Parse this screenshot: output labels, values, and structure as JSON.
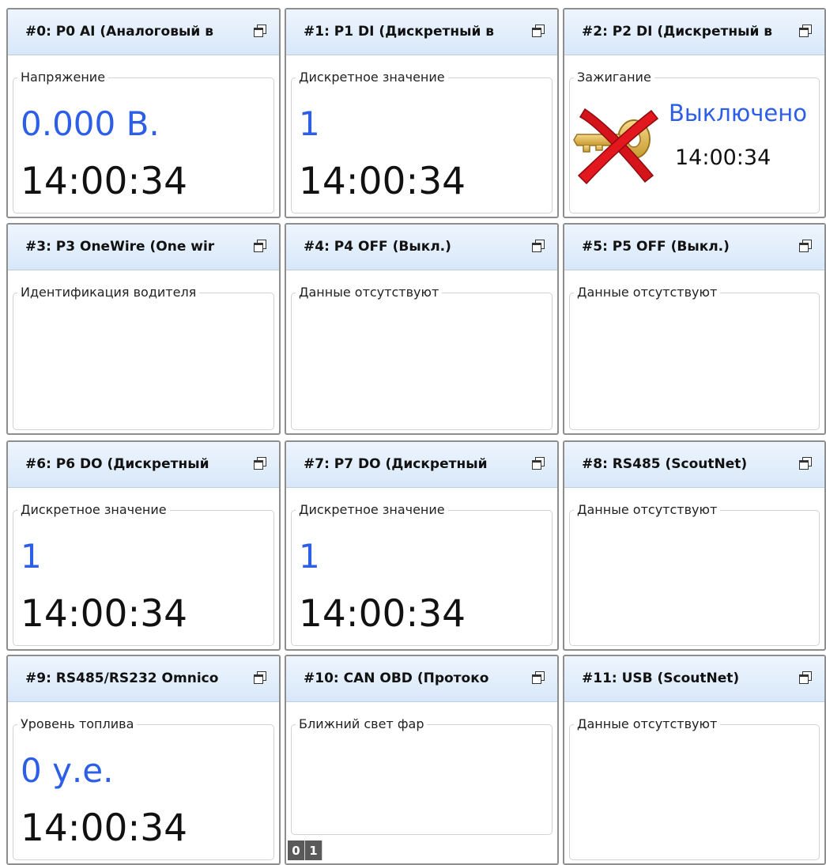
{
  "tiles": [
    {
      "title": "#0: P0 AI (Аналоговый в",
      "legend": "Напряжение",
      "value": "0.000 В.",
      "time": "14:00:34"
    },
    {
      "title": "#1: P1 DI (Дискретный в",
      "legend": "Дискретное значение",
      "value": "1",
      "time": "14:00:34"
    },
    {
      "title": "#2: P2 DI (Дискретный в",
      "legend": "Зажигание",
      "value": "Выключено",
      "time": "14:00:34"
    },
    {
      "title": "#3: P3 OneWire (One wir",
      "legend": "Идентификация водителя"
    },
    {
      "title": "#4: P4 OFF (Выкл.)",
      "legend": "Данные отсутствуют"
    },
    {
      "title": "#5: P5 OFF (Выкл.)",
      "legend": "Данные отсутствуют"
    },
    {
      "title": "#6: P6 DO (Дискретный",
      "legend": "Дискретное значение",
      "value": "1",
      "time": "14:00:34"
    },
    {
      "title": "#7: P7 DO (Дискретный",
      "legend": "Дискретное значение",
      "value": "1",
      "time": "14:00:34"
    },
    {
      "title": "#8: RS485 (ScoutNet)",
      "legend": "Данные отсутствуют"
    },
    {
      "title": "#9: RS485/RS232 Omnico",
      "legend": "Уровень топлива",
      "value": "0 у.е.",
      "time": "14:00:34"
    },
    {
      "title": "#10: CAN OBD (Протоко",
      "legend": "Ближний свет фар"
    },
    {
      "title": "#11: USB (ScoutNet)",
      "legend": "Данные отсутствуют"
    }
  ],
  "bit_indicator": [
    "0",
    "1"
  ],
  "colors": {
    "value_blue": "#2d5ee8",
    "header_top": "#eef5fd",
    "header_bottom": "#d8e8f9"
  }
}
